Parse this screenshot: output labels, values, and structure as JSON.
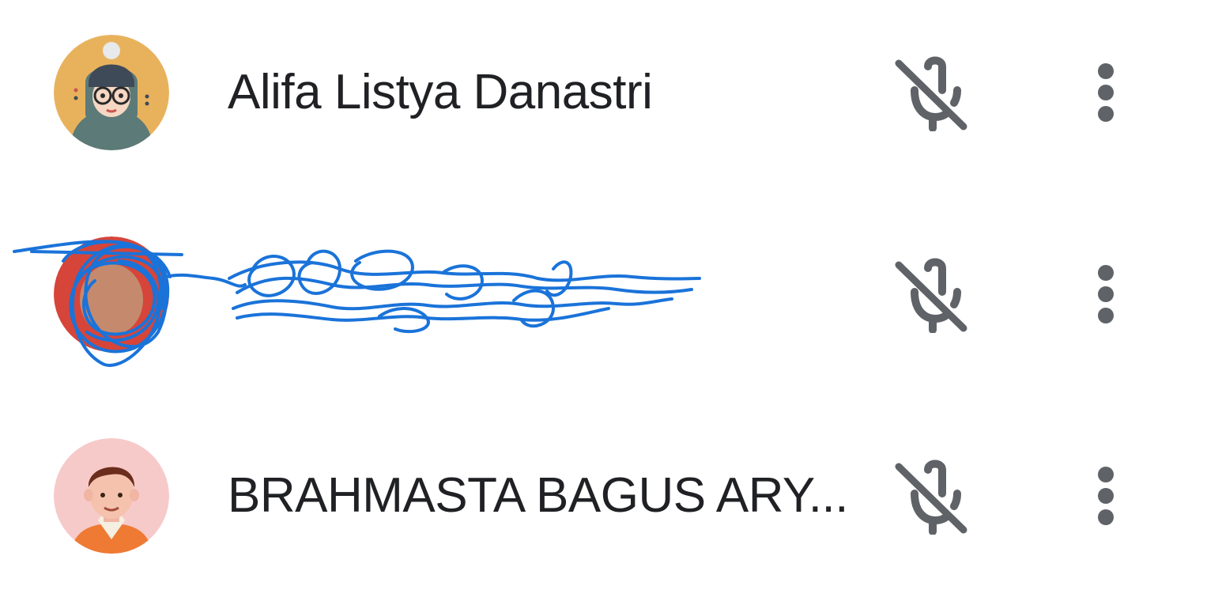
{
  "participants": [
    {
      "name": "Alifa Listya Danastri",
      "avatar": "illustrated-avatar-hijab-glasses",
      "mic_state": "muted",
      "more_icon": "more-vertical-icon"
    },
    {
      "name": "",
      "avatar": "redacted-avatar",
      "mic_state": "muted",
      "more_icon": "more-vertical-icon",
      "redacted": true
    },
    {
      "name": "BRAHMASTA BAGUS ARY...",
      "avatar": "illustrated-avatar-boy",
      "mic_state": "muted",
      "more_icon": "more-vertical-icon"
    }
  ],
  "colors": {
    "text": "#202124",
    "icon": "#5f6368",
    "scribble": "#1a73d9"
  }
}
